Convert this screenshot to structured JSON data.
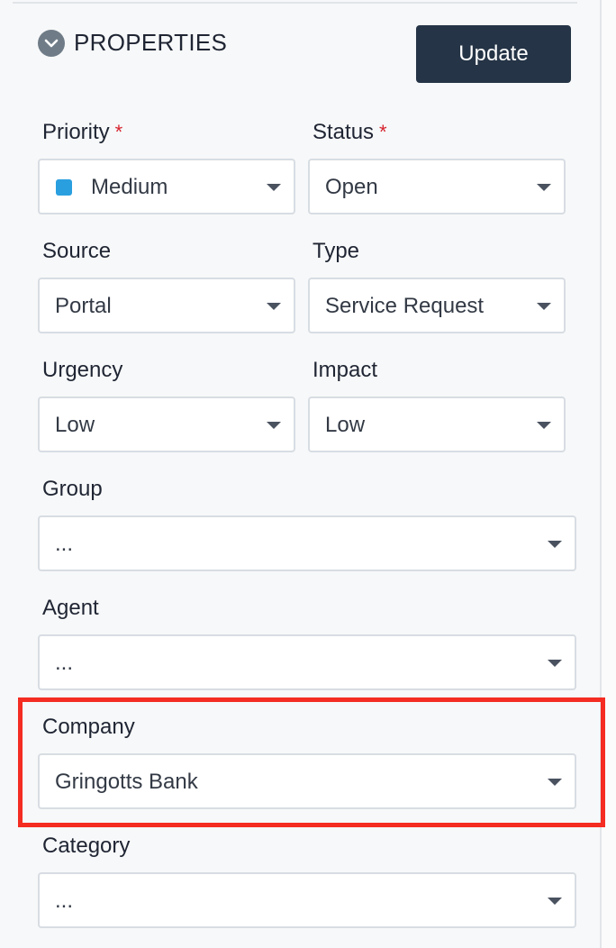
{
  "header": {
    "title": "PROPERTIES",
    "update_label": "Update",
    "toggle_icon": "chevron-down-icon"
  },
  "fields": {
    "priority": {
      "label": "Priority",
      "required": "*",
      "value": "Medium",
      "swatch_color": "#2a9fe0"
    },
    "status": {
      "label": "Status",
      "required": "*",
      "value": "Open"
    },
    "source": {
      "label": "Source",
      "value": "Portal"
    },
    "type": {
      "label": "Type",
      "value": "Service Request"
    },
    "urgency": {
      "label": "Urgency",
      "value": "Low"
    },
    "impact": {
      "label": "Impact",
      "value": "Low"
    },
    "group": {
      "label": "Group",
      "value": "..."
    },
    "agent": {
      "label": "Agent",
      "value": "..."
    },
    "company": {
      "label": "Company",
      "value": "Gringotts Bank"
    },
    "category": {
      "label": "Category",
      "value": "..."
    }
  },
  "colors": {
    "button_bg": "#253446",
    "required_marker": "#d6232f",
    "highlight": "#f42c22"
  }
}
